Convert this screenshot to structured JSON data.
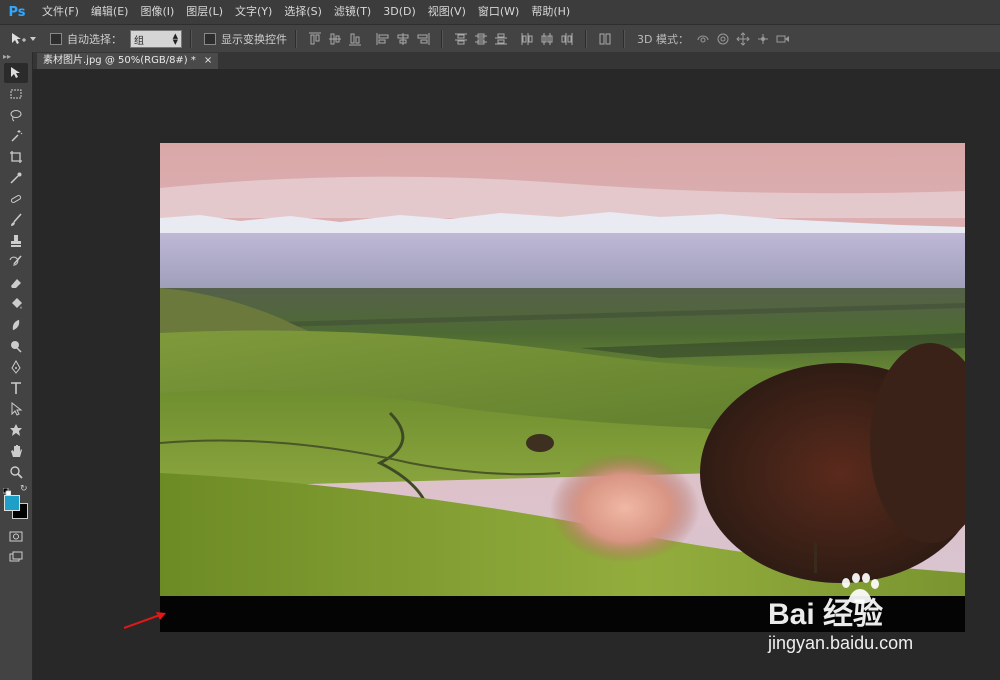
{
  "app": {
    "logo": "Ps"
  },
  "menubar": {
    "items": [
      "文件(F)",
      "编辑(E)",
      "图像(I)",
      "图层(L)",
      "文字(Y)",
      "选择(S)",
      "滤镜(T)",
      "3D(D)",
      "视图(V)",
      "窗口(W)",
      "帮助(H)"
    ]
  },
  "options": {
    "auto_select_label": "自动选择：",
    "auto_select_value": "组",
    "show_transform_label": "显示变换控件",
    "mode_label": "3D 模式："
  },
  "document": {
    "tab_title": "素材图片.jpg @ 50%(RGB/8#) *",
    "close_glyph": "×"
  },
  "colors": {
    "foreground": "#1e9fc8",
    "background": "#000000",
    "accent": "#31a8ff",
    "arrow": "#e01818"
  },
  "watermark": {
    "main": "Bai 经验",
    "sub": "jingyan.baidu.com"
  }
}
